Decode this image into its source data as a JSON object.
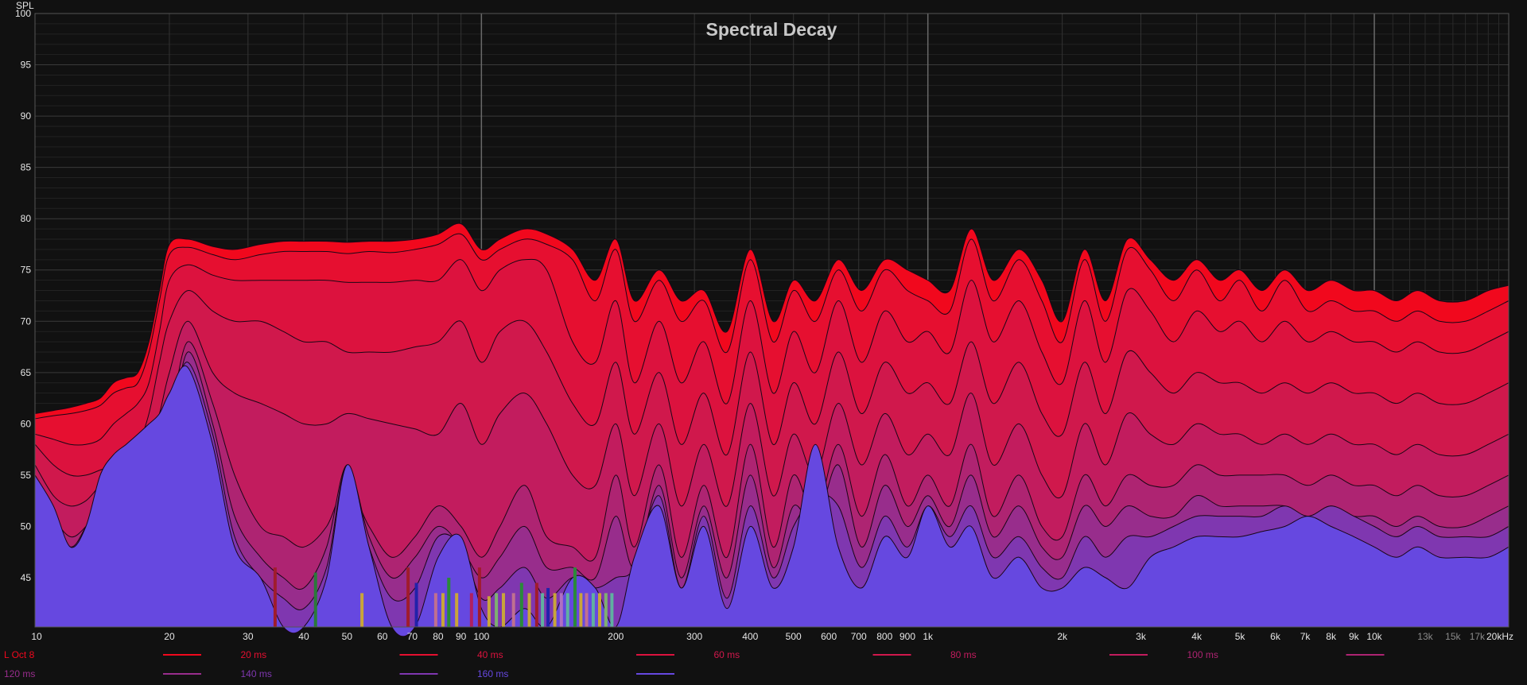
{
  "chart_data": {
    "type": "area",
    "title": "Spectral Decay",
    "ylabel": "SPL",
    "xlabel": "",
    "xscale": "log",
    "xlim": [
      10,
      20000
    ],
    "ylim": [
      40.2,
      100
    ],
    "grid": true,
    "legend_placement": "bottom",
    "yticks": [
      100,
      95,
      90,
      85,
      80,
      75,
      70,
      65,
      60,
      55,
      50,
      45
    ],
    "xticks": [
      {
        "v": 10,
        "label": "10"
      },
      {
        "v": 20,
        "label": "20"
      },
      {
        "v": 30,
        "label": "30"
      },
      {
        "v": 40,
        "label": "40"
      },
      {
        "v": 50,
        "label": "50"
      },
      {
        "v": 60,
        "label": "60"
      },
      {
        "v": 70,
        "label": "70"
      },
      {
        "v": 80,
        "label": "80"
      },
      {
        "v": 90,
        "label": "90"
      },
      {
        "v": 100,
        "label": "100"
      },
      {
        "v": 200,
        "label": "200"
      },
      {
        "v": 300,
        "label": "300"
      },
      {
        "v": 400,
        "label": "400"
      },
      {
        "v": 500,
        "label": "500"
      },
      {
        "v": 600,
        "label": "600"
      },
      {
        "v": 700,
        "label": "700"
      },
      {
        "v": 800,
        "label": "800"
      },
      {
        "v": 900,
        "label": "900"
      },
      {
        "v": 1000,
        "label": "1k"
      },
      {
        "v": 2000,
        "label": "2k"
      },
      {
        "v": 3000,
        "label": "3k"
      },
      {
        "v": 4000,
        "label": "4k"
      },
      {
        "v": 5000,
        "label": "5k"
      },
      {
        "v": 6000,
        "label": "6k"
      },
      {
        "v": 7000,
        "label": "7k"
      },
      {
        "v": 8000,
        "label": "8k"
      },
      {
        "v": 9000,
        "label": "9k"
      },
      {
        "v": 10000,
        "label": "10k"
      },
      {
        "v": 13000,
        "label": "13k",
        "dim": true
      },
      {
        "v": 15000,
        "label": "15k",
        "dim": true
      },
      {
        "v": 17000,
        "label": "17k",
        "dim": true
      },
      {
        "v": 20000,
        "label": "20kHz"
      }
    ],
    "x": [
      10,
      11,
      12,
      13,
      14,
      15,
      16,
      17,
      18,
      19,
      20,
      22,
      25,
      28,
      32,
      36,
      40,
      45,
      50,
      56,
      63,
      71,
      80,
      90,
      100,
      110,
      125,
      140,
      160,
      180,
      200,
      220,
      250,
      280,
      315,
      355,
      400,
      450,
      500,
      560,
      630,
      710,
      800,
      900,
      1000,
      1120,
      1250,
      1400,
      1600,
      1800,
      2000,
      2240,
      2500,
      2800,
      3150,
      3550,
      4000,
      4500,
      5000,
      5600,
      6300,
      7100,
      8000,
      9000,
      10000,
      11200,
      12500,
      14000,
      16000,
      18000,
      20000
    ],
    "series": [
      {
        "name": "L Oct 8",
        "color": "#f1081d",
        "values": [
          61,
          61.3,
          61.6,
          62,
          62.5,
          64,
          64.5,
          65,
          68,
          73,
          77.5,
          78,
          77.3,
          77,
          77.5,
          77.8,
          77.8,
          77.8,
          77.7,
          77.8,
          77.8,
          78,
          78.5,
          79.5,
          77,
          78,
          79,
          78.5,
          77,
          74,
          78,
          72,
          75,
          72,
          73,
          69,
          77,
          70,
          74,
          72,
          76,
          73,
          76,
          75,
          74,
          73,
          79,
          74,
          77,
          74,
          70,
          77,
          72,
          78,
          76,
          74,
          76,
          74,
          75,
          73,
          75,
          73,
          74,
          73,
          73,
          72,
          73,
          72,
          72,
          73,
          73.5
        ]
      },
      {
        "name": "20 ms",
        "color": "#e60f30",
        "values": [
          60.5,
          60.8,
          61,
          61.3,
          61.8,
          63,
          63.5,
          64,
          67,
          72,
          76.5,
          77.2,
          76.5,
          76,
          76.5,
          76.8,
          76.8,
          76.8,
          76.6,
          76.8,
          76.7,
          77,
          77.5,
          78.5,
          76,
          77,
          78,
          77.5,
          76,
          72,
          77,
          70,
          74,
          70,
          72,
          67,
          76,
          68,
          73,
          70,
          75,
          71,
          75,
          73,
          72,
          71,
          78,
          72,
          76,
          72,
          68,
          76,
          70,
          77,
          75,
          72,
          75,
          72,
          74,
          71,
          74,
          71,
          72,
          71,
          71,
          70,
          71,
          70,
          70,
          71,
          72
        ]
      },
      {
        "name": "40 ms",
        "color": "#dc123e",
        "values": [
          59,
          58.5,
          58,
          58,
          58.5,
          60,
          61,
          62,
          64,
          69,
          74,
          75.5,
          74.5,
          74,
          74,
          74,
          74,
          74,
          73.8,
          73.8,
          73.8,
          74,
          74,
          76,
          73,
          75,
          76,
          75,
          68,
          66,
          72,
          64,
          70,
          64,
          68,
          62,
          72,
          63,
          69,
          65,
          72,
          66,
          71,
          68,
          69,
          67,
          74,
          68,
          72,
          67,
          64,
          72,
          66,
          73,
          71,
          68,
          71,
          69,
          70,
          68,
          70,
          68,
          69,
          68,
          68,
          67,
          68,
          67,
          67,
          68,
          69
        ]
      },
      {
        "name": "60 ms",
        "color": "#d0184c",
        "values": [
          58,
          56,
          55,
          55,
          55.5,
          56,
          57,
          58,
          61,
          66,
          70,
          73,
          71,
          70,
          70,
          69,
          68,
          68,
          67,
          67,
          67,
          67.5,
          68,
          70,
          66,
          69,
          70,
          67,
          62,
          60,
          66,
          59,
          65,
          58,
          63,
          57,
          67,
          58,
          64,
          60,
          67,
          61,
          66,
          63,
          64,
          62,
          68,
          62,
          66,
          61,
          59,
          66,
          61,
          67,
          65,
          63,
          65,
          64,
          64,
          63,
          64,
          63,
          64,
          63,
          63,
          62,
          63,
          62,
          62,
          63,
          64
        ]
      },
      {
        "name": "80 ms",
        "color": "#c21c5e",
        "values": [
          56,
          53,
          52,
          52.5,
          54,
          55,
          55.5,
          56,
          58,
          61,
          65,
          70,
          65,
          63,
          62,
          61,
          60,
          60,
          61,
          60.5,
          60,
          59.5,
          59,
          62,
          58,
          61,
          63,
          60,
          55,
          54,
          60,
          53,
          60,
          52,
          58,
          52,
          62,
          53,
          59,
          55,
          62,
          56,
          61,
          57,
          59,
          57,
          63,
          56,
          60,
          55,
          53,
          60,
          56,
          61,
          59,
          58,
          60,
          59,
          59,
          58,
          59,
          58,
          59,
          58,
          58,
          57,
          58,
          57,
          57,
          58,
          59
        ]
      },
      {
        "name": "100 ms",
        "color": "#ae2472",
        "values": [
          55,
          51,
          49,
          50,
          52,
          53,
          53.5,
          54,
          56,
          58,
          60,
          68,
          62,
          55,
          50,
          49,
          48,
          50,
          54,
          50,
          47,
          49,
          52,
          50,
          47,
          50,
          54,
          49,
          48,
          47,
          55,
          48,
          56,
          47,
          54,
          47,
          58,
          48,
          55,
          51,
          58,
          51,
          57,
          52,
          55,
          52,
          58,
          51,
          55,
          50,
          49,
          55,
          52,
          55,
          54,
          54,
          56,
          55,
          55,
          55,
          55,
          54,
          55,
          54,
          54,
          53,
          54,
          53,
          53,
          54,
          55
        ]
      },
      {
        "name": "120 ms",
        "color": "#982d8c",
        "values": [
          55,
          50,
          48,
          49.5,
          51,
          53,
          54,
          55,
          56,
          57,
          58,
          67,
          60,
          51,
          47,
          45,
          44,
          48,
          56,
          49,
          45,
          47,
          50,
          48,
          45,
          47,
          50,
          46,
          46,
          45,
          51,
          46,
          54,
          45,
          52,
          45,
          55,
          46,
          52,
          50,
          56,
          48,
          54,
          50,
          53,
          50,
          55,
          49,
          52,
          48,
          47,
          52,
          50,
          52,
          51,
          51,
          53,
          52,
          52,
          52,
          52,
          51,
          52,
          51,
          51,
          50,
          51,
          50,
          50,
          51,
          52
        ]
      },
      {
        "name": "140 ms",
        "color": "#7f37b0",
        "values": [
          55,
          51,
          48,
          50,
          53,
          55,
          56,
          57,
          58,
          59,
          61,
          66,
          59,
          49,
          45,
          43,
          42,
          46,
          56,
          48,
          43,
          44,
          49,
          48,
          43,
          44,
          46,
          43,
          45,
          44,
          45,
          46,
          53,
          44,
          51,
          43,
          52,
          45,
          50,
          53,
          52,
          46,
          51,
          48,
          52,
          49,
          52,
          47,
          49,
          46,
          45,
          49,
          47,
          49,
          49,
          50,
          51,
          51,
          51,
          51,
          52,
          51,
          52,
          51,
          50,
          49,
          50,
          49,
          49,
          49,
          50
        ]
      },
      {
        "name": "160 ms",
        "color": "#6648e0",
        "values": [
          55,
          52,
          48,
          50,
          55,
          57,
          58,
          59,
          60,
          61,
          63,
          65.5,
          58,
          48,
          45,
          40,
          40,
          45,
          56,
          48,
          40,
          40,
          47,
          49,
          42,
          40,
          42,
          40,
          45,
          44,
          40,
          47,
          52,
          44,
          50,
          42,
          50,
          44,
          48,
          58,
          48,
          44,
          49,
          47,
          52,
          48,
          50,
          45,
          47,
          44,
          44,
          46,
          45,
          44,
          47,
          48,
          49,
          49,
          49,
          49.5,
          50,
          51,
          50,
          49,
          48,
          47,
          48,
          47,
          47,
          47,
          48
        ]
      }
    ],
    "markers": [
      {
        "f": 34.5,
        "top": 46,
        "color": "#a01c2c"
      },
      {
        "f": 42.5,
        "top": 45.5,
        "color": "#2a7a3a"
      },
      {
        "f": 54,
        "top": 43.5,
        "color": "#c9a53a"
      },
      {
        "f": 68.5,
        "top": 46,
        "color": "#a01c2c"
      },
      {
        "f": 71.5,
        "top": 44.5,
        "color": "#2222aa"
      },
      {
        "f": 79,
        "top": 43.5,
        "color": "#c07090"
      },
      {
        "f": 82,
        "top": 43.5,
        "color": "#c9a53a"
      },
      {
        "f": 84.5,
        "top": 45,
        "color": "#2a8a3a"
      },
      {
        "f": 88,
        "top": 43.5,
        "color": "#c9a53a"
      },
      {
        "f": 95,
        "top": 43.5,
        "color": "#b02060"
      },
      {
        "f": 99,
        "top": 46,
        "color": "#a01c2c"
      },
      {
        "f": 104,
        "top": 43.2,
        "color": "#c9a53a"
      },
      {
        "f": 108,
        "top": 43.5,
        "color": "#7fb070"
      },
      {
        "f": 112,
        "top": 43.5,
        "color": "#c9a53a"
      },
      {
        "f": 118,
        "top": 43.5,
        "color": "#c07090"
      },
      {
        "f": 123,
        "top": 44.5,
        "color": "#2a8a3a"
      },
      {
        "f": 128,
        "top": 43.5,
        "color": "#c9a53a"
      },
      {
        "f": 133,
        "top": 44.5,
        "color": "#a01c2c"
      },
      {
        "f": 137,
        "top": 43.5,
        "color": "#60b0a0"
      },
      {
        "f": 141,
        "top": 44,
        "color": "#2222aa"
      },
      {
        "f": 146,
        "top": 43.5,
        "color": "#c9a53a"
      },
      {
        "f": 151,
        "top": 43.5,
        "color": "#b070c0"
      },
      {
        "f": 156,
        "top": 43.5,
        "color": "#60b0a0"
      },
      {
        "f": 162,
        "top": 46,
        "color": "#2a8a3a"
      },
      {
        "f": 167,
        "top": 43.5,
        "color": "#c9a53a"
      },
      {
        "f": 172,
        "top": 43.5,
        "color": "#c07090"
      },
      {
        "f": 178,
        "top": 43.5,
        "color": "#60b0a0"
      },
      {
        "f": 184,
        "top": 43.5,
        "color": "#c9a53a"
      },
      {
        "f": 190,
        "top": 43.5,
        "color": "#7fb070"
      },
      {
        "f": 196,
        "top": 43.5,
        "color": "#60b0a0"
      }
    ]
  }
}
